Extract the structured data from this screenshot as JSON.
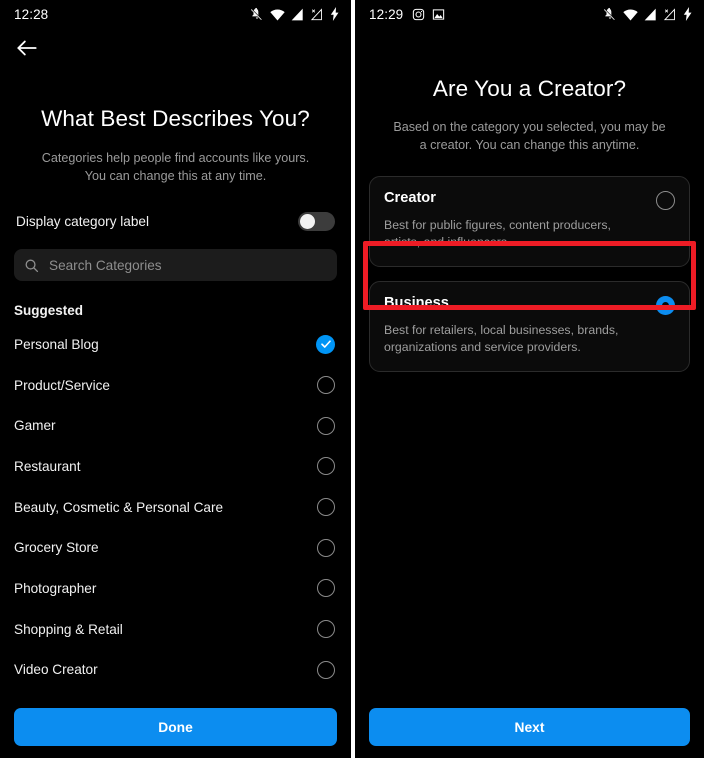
{
  "left_screen": {
    "status_bar": {
      "clock": "12:28",
      "right_icons": [
        "bell-off-icon",
        "wifi-icon",
        "signal-icon",
        "signal-no-sim-icon",
        "charging-bolt-icon"
      ]
    },
    "back_button": "back-arrow-icon",
    "title": "What Best Describes You?",
    "subtitle": "Categories help people find accounts like yours. You can change this at any time.",
    "toggle": {
      "label": "Display category label",
      "state": "off"
    },
    "search": {
      "placeholder": "Search Categories",
      "value": "",
      "icon": "search-icon"
    },
    "section_header": "Suggested",
    "categories": [
      {
        "label": "Personal Blog",
        "selected": true
      },
      {
        "label": "Product/Service",
        "selected": false
      },
      {
        "label": "Gamer",
        "selected": false
      },
      {
        "label": "Restaurant",
        "selected": false
      },
      {
        "label": "Beauty, Cosmetic & Personal Care",
        "selected": false
      },
      {
        "label": "Grocery Store",
        "selected": false
      },
      {
        "label": "Photographer",
        "selected": false
      },
      {
        "label": "Shopping & Retail",
        "selected": false
      },
      {
        "label": "Video Creator",
        "selected": false
      }
    ],
    "primary_button": "Done"
  },
  "right_screen": {
    "status_bar": {
      "clock": "12:29",
      "left_icons": [
        "instagram-icon",
        "photo-icon"
      ],
      "right_icons": [
        "bell-off-icon",
        "wifi-icon",
        "signal-icon",
        "signal-no-sim-icon",
        "charging-bolt-icon"
      ]
    },
    "title": "Are You a Creator?",
    "subtitle": "Based on the category you selected, you may be a creator. You can change this anytime.",
    "options": [
      {
        "title": "Creator",
        "description": "Best for public figures, content producers, artists, and influencers.",
        "selected": false
      },
      {
        "title": "Business",
        "description": "Best for retailers, local businesses, brands, organizations and service providers.",
        "selected": true
      }
    ],
    "primary_button": "Next"
  },
  "annotation": {
    "highlight_color": "#ee1c25",
    "target": "Business"
  },
  "colors": {
    "accent_blue": "#0c8df0",
    "check_blue": "#0095f6",
    "background": "#000000",
    "card_bg": "#0b0b0b",
    "muted_text": "#9b9b9b"
  }
}
